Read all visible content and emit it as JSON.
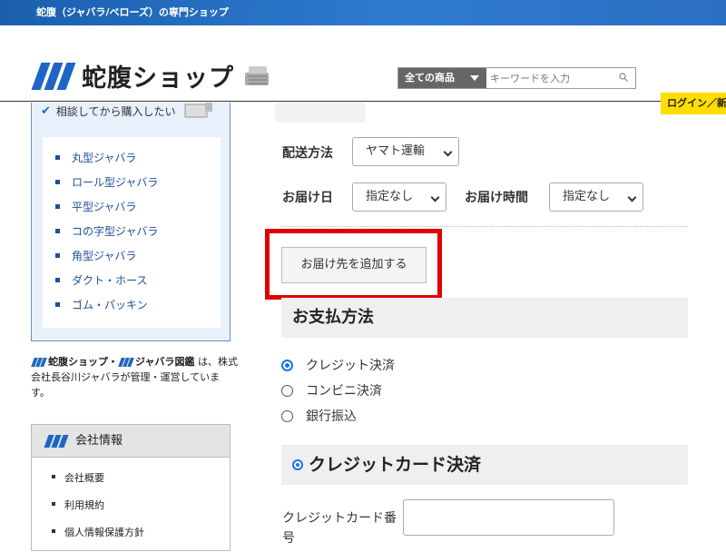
{
  "topbar": {
    "text": "蛇腹（ジャバラ/ベローズ）の専門ショップ"
  },
  "header": {
    "logo_text": "蛇腹ショップ",
    "search": {
      "category": "全ての商品",
      "placeholder": "キーワードを入力"
    },
    "login": "ログイン／新規"
  },
  "sidebar": {
    "consult": "相談してから購入したい",
    "categories": [
      "丸型ジャバラ",
      "ロール型ジャバラ",
      "平型ジャバラ",
      "コの字型ジャバラ",
      "角型ジャバラ",
      "ダクト・ホース",
      "ゴム・パッキン"
    ],
    "managed": {
      "shop": "蛇腹ショップ",
      "sep": "・",
      "zukan": "ジャバラ図鑑",
      "rest": " は、株式会社長谷川ジャバラが管理・運営しています。"
    },
    "company": {
      "title": "会社情報",
      "items": [
        "会社概要",
        "利用規約",
        "個人情報保護方針"
      ]
    }
  },
  "main": {
    "shipping_label": "配送方法",
    "shipping_value": "ヤマト運輸",
    "date_label": "お届け日",
    "date_value": "指定なし",
    "time_label": "お届け時間",
    "time_value": "指定なし",
    "add_address": "お届け先を追加する",
    "payment_title": "お支払方法",
    "payment_options": [
      "クレジット決済",
      "コンビニ決済",
      "銀行振込"
    ],
    "payment_selected": 0,
    "cc_title": "クレジットカード決済",
    "cc_number_label": "クレジットカード番号"
  },
  "colors": {
    "brand_blue": "#1e66c4",
    "highlight_red": "#e00000",
    "login_yellow": "#ffdd00"
  }
}
